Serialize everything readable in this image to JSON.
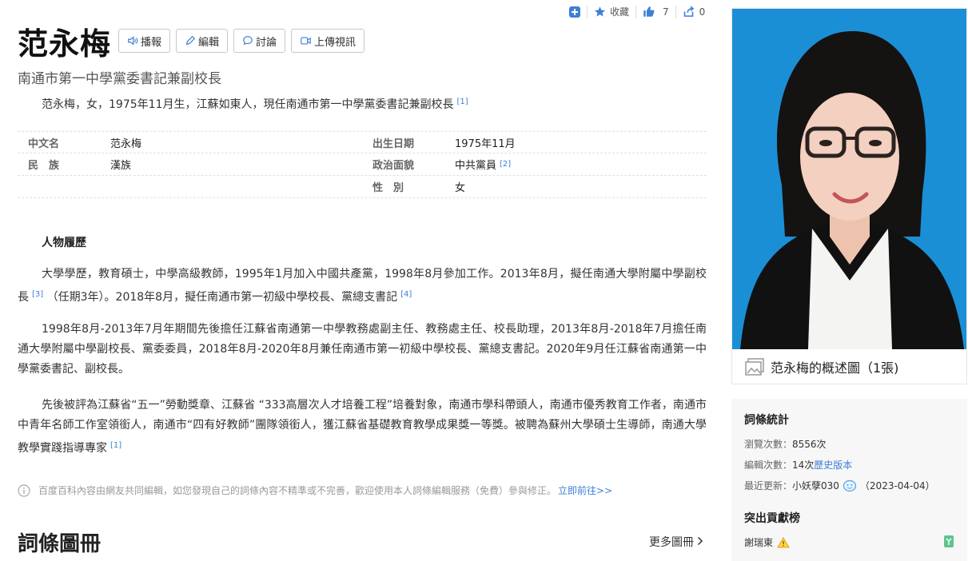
{
  "topbar": {
    "collect_label": "收藏",
    "like_count": "7",
    "share_count": "0"
  },
  "header": {
    "title": "范永梅",
    "buttons": [
      "播報",
      "編輯",
      "討論",
      "上傳視訊"
    ],
    "subtitle": "南通市第一中學黨委書記兼副校長",
    "summary": "范永梅，女，1975年11月生，江蘇如東人，現任南通市第一中學黨委書記兼副校長",
    "summary_ref": "[1]"
  },
  "info": {
    "rows": [
      {
        "k1": "中文名",
        "v1": "范永梅",
        "k2": "出生日期",
        "v2": "1975年11月",
        "ref2": ""
      },
      {
        "k1": "民　族",
        "v1": "漢族",
        "k2": "政治面貌",
        "v2": "中共黨員",
        "ref2": "[2]"
      },
      {
        "k1": "",
        "v1": "",
        "k2": "性　別",
        "v2": "女",
        "ref2": ""
      }
    ]
  },
  "article": {
    "section_title": "人物履歷",
    "p1_a": "大學學歷，教育碩士，中學高級教師，1995年1月加入中國共產黨，1998年8月參加工作。2013年8月，擬任南通大學附屬中學副校長",
    "p1_ref1": "[3]",
    "p1_b": "（任期3年）。2018年8月，擬任南通市第一初級中學校長、黨總支書記",
    "p1_ref2": "[4]",
    "p2": "1998年8月-2013年7月年期間先後擔任江蘇省南通第一中學教務處副主任、教務處主任、校長助理，2013年8月-2018年7月擔任南通大學附屬中學副校長、黨委委員，2018年8月-2020年8月兼任南通市第一初級中學校長、黨總支書記。2020年9月任江蘇省南通第一中學黨委書記、副校長。",
    "p3": "先後被評為江蘇省“五一”勞動獎章、江蘇省 “333高層次人才培養工程”培養對象，南通市學科帶頭人，南通市優秀教育工作者，南通市中青年名師工作室領銜人，南通市“四有好教師”團隊領銜人，獲江蘇省基礎教育教學成果獎一等獎。被聘為蘇州大學碩士生導師，南通大學教學實踐指導專家",
    "p3_ref": "[1]"
  },
  "note": {
    "text": "百度百科內容由網友共同編輯，如您發現自己的詞條內容不精準或不完善，歡迎使用本人詞條編輯服務（免費）參與修正。",
    "link": "立即前往>>"
  },
  "gallery": {
    "title": "詞條圖冊",
    "more": "更多圖冊"
  },
  "image_card": {
    "caption": "范永梅的概述圖（1張)"
  },
  "stats": {
    "title": "詞條統計",
    "views_label": "瀏覽次數：",
    "views": "8556次",
    "edits_label": "編輯次數：",
    "edits": "14次",
    "history": "歷史版本",
    "updated_label": "最近更新：",
    "updated_user": "小妖孽030",
    "updated_date": "（2023-04-04）",
    "contrib_title": "突出貢獻榜",
    "contributor": "謝瑞東"
  },
  "colors": {
    "accent": "#3e7fd5",
    "photo_bg": "#1a8fd6"
  }
}
